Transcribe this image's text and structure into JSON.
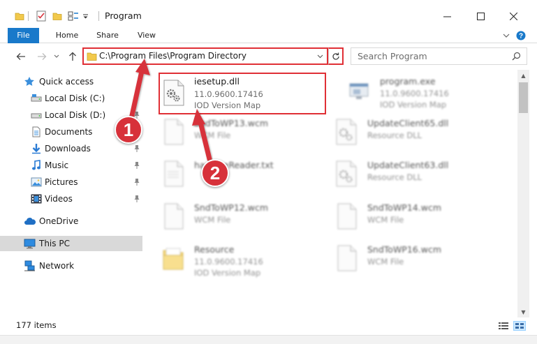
{
  "window": {
    "title": "Program",
    "controls": {
      "minimize": "—",
      "maximize": "☐",
      "close": "✕"
    }
  },
  "ribbon": {
    "tabs": [
      "File",
      "Home",
      "Share",
      "View"
    ],
    "help": "?"
  },
  "address": {
    "path": "C:\\Program Files\\Program Directory"
  },
  "search": {
    "placeholder": "Search Program"
  },
  "nav_pane": {
    "quick_access": "Quick access",
    "items": [
      {
        "label": "Local Disk (C:)",
        "icon": "drive-icon",
        "pinned": false
      },
      {
        "label": "Local Disk (D:)",
        "icon": "drive-icon",
        "pinned": true
      },
      {
        "label": "Documents",
        "icon": "documents-icon",
        "pinned": true
      },
      {
        "label": "Downloads",
        "icon": "downloads-icon",
        "pinned": true
      },
      {
        "label": "Music",
        "icon": "music-icon",
        "pinned": true
      },
      {
        "label": "Pictures",
        "icon": "pictures-icon",
        "pinned": true
      },
      {
        "label": "Videos",
        "icon": "videos-icon",
        "pinned": true
      }
    ],
    "onedrive": "OneDrive",
    "this_pc": "This PC",
    "network": "Network"
  },
  "files": [
    {
      "name": "iesetup.dll",
      "line1": "11.0.9600.17416",
      "line2": "IOD Version Map",
      "icon": "dll-gear-icon",
      "highlighted": true
    },
    {
      "name": "program.exe",
      "line1": "11.0.9600.17416",
      "line2": "IOD Version Map",
      "icon": "exe-icon",
      "highlighted": false
    },
    {
      "name": "SndToWP13.wcm",
      "line1": "WCM File",
      "line2": "",
      "icon": "blank-file-icon",
      "highlighted": false
    },
    {
      "name": "UpdateClient65.dll",
      "line1": "Resource DLL",
      "line2": "",
      "icon": "dll-gear-icon",
      "highlighted": false
    },
    {
      "name": "handweReader.txt",
      "line1": "",
      "line2": "",
      "icon": "text-file-icon",
      "highlighted": false
    },
    {
      "name": "UpdateClient63.dll",
      "line1": "Resource DLL",
      "line2": "",
      "icon": "dll-gear-icon",
      "highlighted": false
    },
    {
      "name": "SndToWP12.wcm",
      "line1": "WCM File",
      "line2": "",
      "icon": "blank-file-icon",
      "highlighted": false
    },
    {
      "name": "SndToWP14.wcm",
      "line1": "WCM File",
      "line2": "",
      "icon": "blank-file-icon",
      "highlighted": false
    },
    {
      "name": "Resource",
      "line1": "11.0.9600.17416",
      "line2": "IOD Version Map",
      "icon": "folder-icon",
      "highlighted": false
    },
    {
      "name": "SndToWP16.wcm",
      "line1": "WCM File",
      "line2": "",
      "icon": "blank-file-icon",
      "highlighted": false
    }
  ],
  "status": {
    "item_count": "177 items"
  },
  "callouts": [
    "1",
    "2"
  ],
  "colors": {
    "accent": "#1979ca",
    "highlight_red": "#e02f35",
    "callout_red": "#d7313a",
    "folder_yellow": "#f2c94c"
  }
}
